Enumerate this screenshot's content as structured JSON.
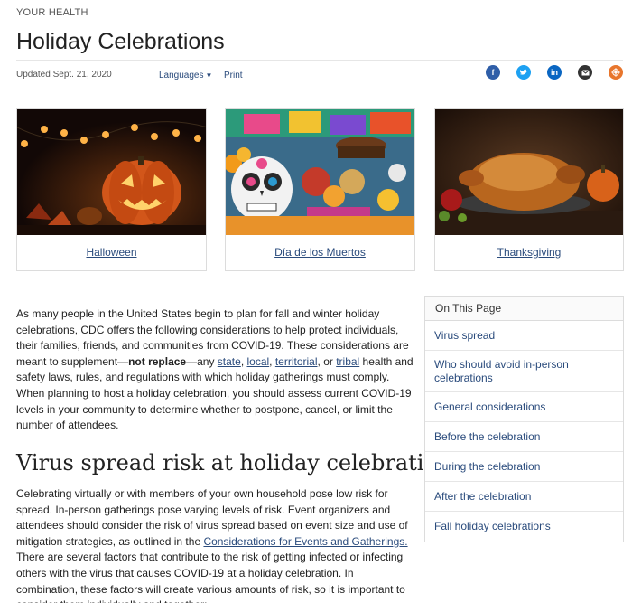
{
  "header": {
    "eyebrow": "YOUR HEALTH",
    "title": "Holiday Celebrations",
    "updated": "Updated Sept. 21, 2020",
    "languages": "Languages",
    "print": "Print"
  },
  "share_icons": [
    "facebook-icon",
    "twitter-icon",
    "linkedin-icon",
    "email-icon",
    "syndicate-icon"
  ],
  "cards": [
    {
      "label": "Halloween"
    },
    {
      "label": "Día de los Muertos"
    },
    {
      "label": "Thanksgiving"
    }
  ],
  "intro": {
    "part1": "As many people in the United States begin to plan for fall and winter holiday celebrations, CDC offers the following considerations to help protect individuals, their families, friends, and communities from COVID-19. These considerations are meant to supplement—",
    "bold": "not replace",
    "part2": "—any ",
    "link_state": "state",
    "sep1": ", ",
    "link_local": "local",
    "sep2": ", ",
    "link_territorial": "territorial",
    "sep3": ", or ",
    "link_tribal": "tribal",
    "part3": " health and safety laws, rules, and regulations with which holiday gatherings must comply. When planning to host a holiday celebration, you should assess current COVID-19 levels in your community to determine whether to postpone, cancel, or limit the number of attendees."
  },
  "section": {
    "heading": "Virus spread risk at holiday celebrations",
    "para1a": "Celebrating virtually or with members of your own household pose low risk for spread. In-person gatherings pose varying levels of risk. Event organizers and attendees should consider the risk of virus spread based on event size and use of mitigation strategies, as outlined in the ",
    "para1_link": "Considerations for Events and Gatherings.",
    "para1b": " There are several factors that contribute to the risk of getting infected or infecting others with the virus that causes COVID-19 at a holiday celebration. In combination, these factors will create various amounts of risk, so it is important to consider them individually and together:"
  },
  "on_this_page": {
    "title": "On This Page",
    "items": [
      "Virus spread",
      "Who should avoid in-person celebrations",
      "General considerations",
      "Before the celebration",
      "During the celebration",
      "After the celebration",
      "Fall holiday celebrations"
    ]
  }
}
